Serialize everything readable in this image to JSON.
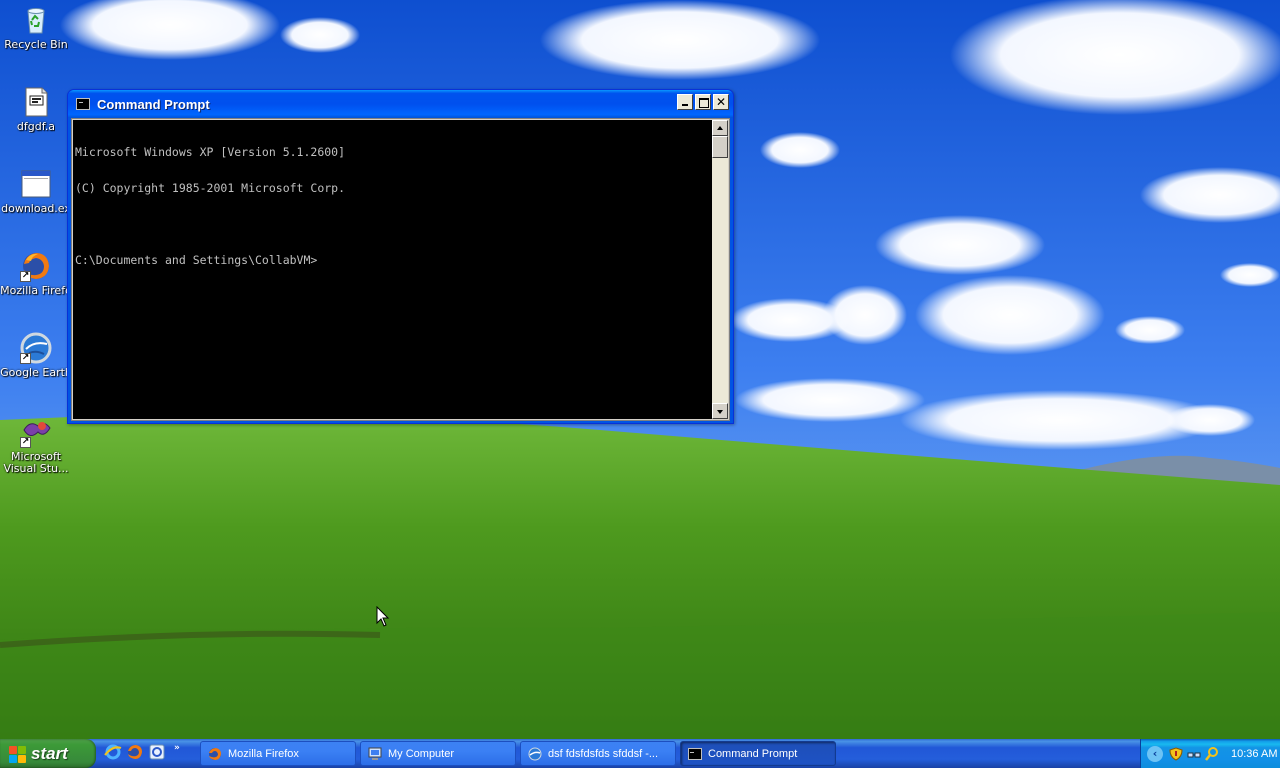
{
  "desktop": {
    "icons": [
      {
        "label": "Recycle Bin",
        "icon": "recycle-bin-icon"
      },
      {
        "label": "dfgdf.a",
        "icon": "file-icon"
      },
      {
        "label": "download.ex",
        "icon": "exe-window-icon"
      },
      {
        "label": "Mozilla Firefo",
        "icon": "firefox-icon"
      },
      {
        "label": "Google Earth",
        "icon": "google-earth-icon"
      },
      {
        "label": "Microsoft\nVisual Stu...",
        "label_line1": "Microsoft",
        "label_line2": "Visual Stu...",
        "icon": "visual-studio-icon"
      }
    ]
  },
  "window": {
    "title": "Command Prompt",
    "console_lines": [
      "Microsoft Windows XP [Version 5.1.2600]",
      "(C) Copyright 1985-2001 Microsoft Corp.",
      "",
      "C:\\Documents and Settings\\CollabVM>"
    ],
    "close_glyph": "✕"
  },
  "taskbar": {
    "start_label": "start",
    "quick_launch_chevron": "»",
    "buttons": [
      {
        "label": "Mozilla Firefox",
        "icon": "firefox-icon"
      },
      {
        "label": "My Computer",
        "icon": "my-computer-icon"
      },
      {
        "label": "dsf fdsfdsfds sfddsf -...",
        "icon": "earth-icon"
      },
      {
        "label": "Command Prompt",
        "icon": "cmd-icon"
      }
    ],
    "tray": {
      "chevron": "‹",
      "clock": "10:36 AM"
    }
  },
  "colors": {
    "titlebar": "#0054e3",
    "taskbar": "#245edb",
    "start": "#3c9a38",
    "console_bg": "#000000",
    "console_fg": "#c0c0c0"
  }
}
